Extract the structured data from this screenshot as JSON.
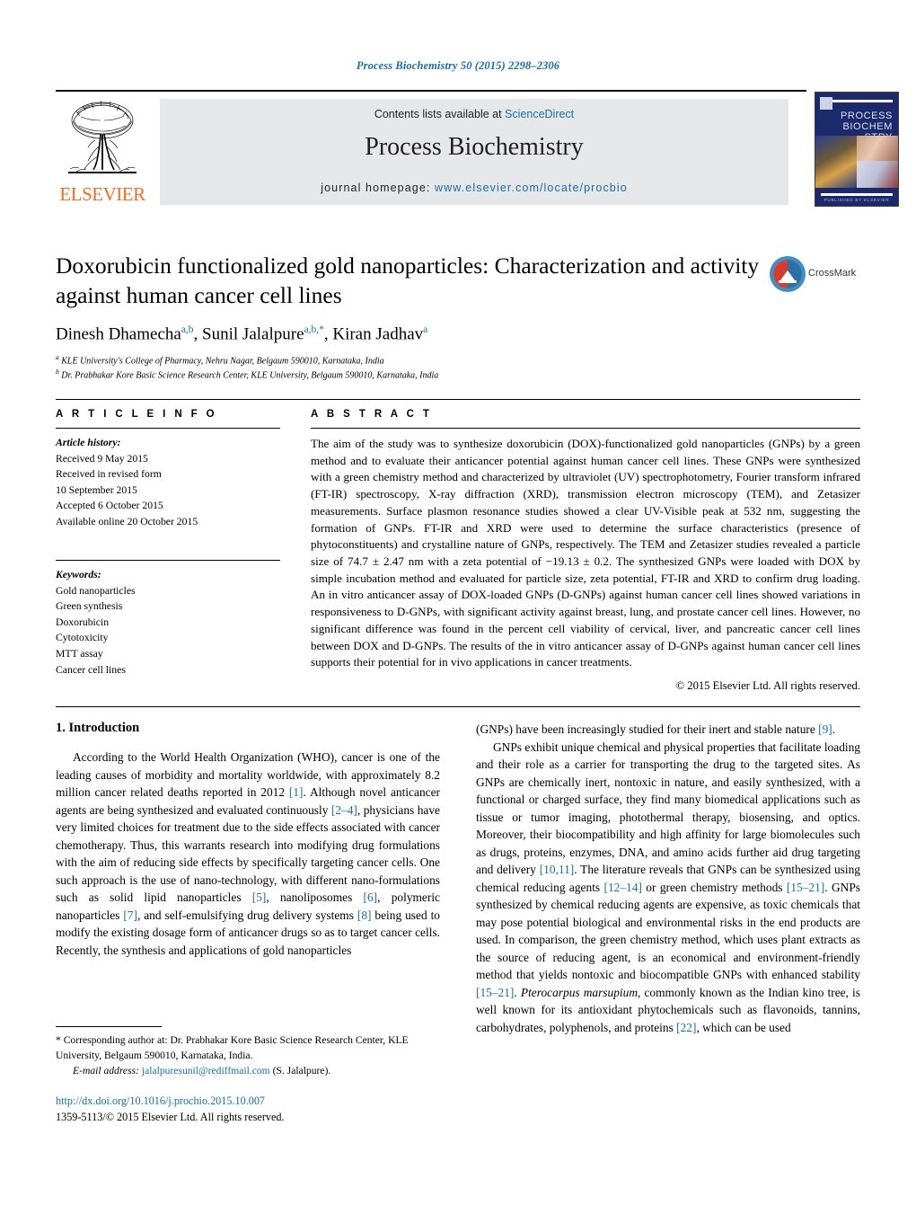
{
  "running_head": "Process Biochemistry 50 (2015) 2298–2306",
  "masthead": {
    "contents_prefix": "Contents lists available at ",
    "sciencedirect": "ScienceDirect",
    "journal_title": "Process Biochemistry",
    "homepage_label": "journal homepage:",
    "homepage_url": "www.elsevier.com/locate/procbio",
    "publisher_wordmark": "ELSEVIER",
    "cover": {
      "line1": "PROCESS",
      "line2": "BIOCHEM STRY",
      "footer": "PUBLISHED BY ELSEVIER"
    }
  },
  "article": {
    "title": "Doxorubicin functionalized gold nanoparticles: Characterization and activity against human cancer cell lines",
    "authors": [
      {
        "name": "Dinesh Dhamecha",
        "sup": "a,b"
      },
      {
        "name": "Sunil Jalalpure",
        "sup": "a,b,*"
      },
      {
        "name": "Kiran Jadhav",
        "sup": "a"
      }
    ],
    "affiliations": [
      {
        "mark": "a",
        "text": "KLE University's College of Pharmacy, Nehru Nagar, Belgaum 590010, Karnataka, India"
      },
      {
        "mark": "b",
        "text": "Dr. Prabhakar Kore Basic Science Research Center, KLE University, Belgaum 590010, Karnataka, India"
      }
    ],
    "crossmark_label": "CrossMark"
  },
  "article_info": {
    "heading": "A R T I C L E   I N F O",
    "history_label": "Article history:",
    "history": [
      "Received 9 May 2015",
      "Received in revised form",
      "10 September 2015",
      "Accepted 6 October 2015",
      "Available online 20 October 2015"
    ],
    "keywords_label": "Keywords:",
    "keywords": [
      "Gold nanoparticles",
      "Green synthesis",
      "Doxorubicin",
      "Cytotoxicity",
      "MTT assay",
      "Cancer cell lines"
    ]
  },
  "abstract": {
    "heading": "A B S T R A C T",
    "text": "The aim of the study was to synthesize doxorubicin (DOX)-functionalized gold nanoparticles (GNPs) by a green method and to evaluate their anticancer potential against human cancer cell lines. These GNPs were synthesized with a green chemistry method and characterized by ultraviolet (UV) spectrophotometry, Fourier transform infrared (FT-IR) spectroscopy, X-ray diffraction (XRD), transmission electron microscopy (TEM), and Zetasizer measurements. Surface plasmon resonance studies showed a clear UV-Visible peak at 532 nm, suggesting the formation of GNPs. FT-IR and XRD were used to determine the surface characteristics (presence of phytoconstituents) and crystalline nature of GNPs, respectively. The TEM and Zetasizer studies revealed a particle size of 74.7 ± 2.47 nm with a zeta potential of −19.13 ± 0.2. The synthesized GNPs were loaded with DOX by simple incubation method and evaluated for particle size, zeta potential, FT-IR and XRD to confirm drug loading. An in vitro anticancer assay of DOX-loaded GNPs (D-GNPs) against human cancer cell lines showed variations in responsiveness to D-GNPs, with significant activity against breast, lung, and prostate cancer cell lines. However, no significant difference was found in the percent cell viability of cervical, liver, and pancreatic cancer cell lines between DOX and D-GNPs. The results of the in vitro anticancer assay of D-GNPs against human cancer cell lines supports their potential for in vivo applications in cancer treatments.",
    "copyright": "© 2015 Elsevier Ltd. All rights reserved."
  },
  "introduction": {
    "heading": "1.  Introduction",
    "left_para_1_a": "According to the World Health Organization (WHO), cancer is one of the leading causes of morbidity and mortality worldwide, with approximately 8.2 million cancer related deaths reported in 2012 ",
    "left_ref_1": "[1]",
    "left_para_1_b": ". Although novel anticancer agents are being synthesized and evaluated continuously ",
    "left_ref_2": "[2–4]",
    "left_para_1_c": ", physicians have very limited choices for treatment due to the side effects associated with cancer chemotherapy. Thus, this warrants research into modifying drug formulations with the aim of reducing side effects by specifically targeting cancer cells. One such approach is the use of nano-technology, with different nano-formulations such as solid lipid nanoparticles ",
    "left_ref_3": "[5]",
    "left_para_1_d": ", nanoliposomes ",
    "left_ref_4": "[6]",
    "left_para_1_e": ", polymeric nanoparticles ",
    "left_ref_5": "[7]",
    "left_para_1_f": ", and self-emulsifying drug delivery systems ",
    "left_ref_6": "[8]",
    "left_para_1_g": " being used to modify the existing dosage form of anticancer drugs so as to target cancer cells. Recently, the synthesis and applications of gold nanoparticles",
    "right_para_1_a": "(GNPs) have been increasingly studied for their inert and stable nature ",
    "right_ref_1": "[9]",
    "right_para_1_b": ".",
    "right_para_2_a": "GNPs exhibit unique chemical and physical properties that facilitate loading and their role as a carrier for transporting the drug to the targeted sites. As GNPs are chemically inert, nontoxic in nature, and easily synthesized, with a functional or charged surface, they find many biomedical applications such as tissue or tumor imaging, photothermal therapy, biosensing, and optics. Moreover, their biocompatibility and high affinity for large biomolecules such as drugs, proteins, enzymes, DNA, and amino acids further aid drug targeting and delivery ",
    "right_ref_2": "[10,11]",
    "right_para_2_b": ". The literature reveals that GNPs can be synthesized using chemical reducing agents ",
    "right_ref_3": "[12–14]",
    "right_para_2_c": " or green chemistry methods ",
    "right_ref_4": "[15–21]",
    "right_para_2_d": ". GNPs synthesized by chemical reducing agents are expensive, as toxic chemicals that may pose potential biological and environmental risks in the end products are used. In comparison, the green chemistry method, which uses plant extracts as the source of reducing agent, is an economical and environment-friendly method that yields nontoxic and biocompatible GNPs with enhanced stability ",
    "right_ref_5": "[15–21]",
    "right_para_2_e": ". ",
    "right_italic_1": "Pterocarpus marsupium",
    "right_para_2_f": ", commonly known as the Indian kino tree, is well known for its antioxidant phytochemicals such as flavonoids, tannins, carbohydrates, polyphenols, and proteins ",
    "right_ref_6": "[22]",
    "right_para_2_g": ", which can be used"
  },
  "footnotes": {
    "corresponding_marker": "*",
    "corresponding_text": " Corresponding author at: Dr. Prabhakar Kore Basic Science Research Center, KLE University, Belgaum 590010, Karnataka, India.",
    "email_label": "E-mail address:",
    "email": "jalalpuresunil@rediffmail.com",
    "email_suffix": " (S. Jalalpure)."
  },
  "doi_block": {
    "doi_url": "http://dx.doi.org/10.1016/j.prochio.2015.10.007",
    "issn_line": "1359-5113/© 2015 Elsevier Ltd. All rights reserved."
  },
  "colors": {
    "link_blue": "#1a6ea0",
    "elsevier_orange": "#F26B21",
    "banner_gray": "#e6e7e9",
    "cover_blue": "#1b2a6b"
  }
}
